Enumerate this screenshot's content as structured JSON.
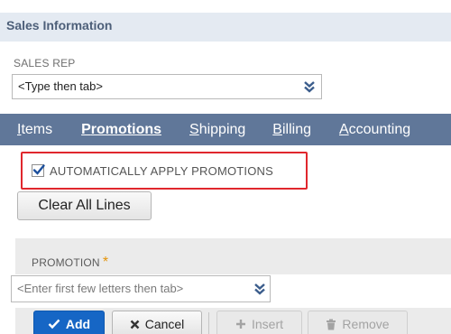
{
  "section": {
    "title": "Sales Information"
  },
  "sales_rep": {
    "label": "SALES REP",
    "value": "<Type then tab>"
  },
  "tabs": [
    {
      "first": "I",
      "rest": "tems"
    },
    {
      "first": "P",
      "rest": "romotions"
    },
    {
      "first": "S",
      "rest": "hipping"
    },
    {
      "first": "B",
      "rest": "illing"
    },
    {
      "first": "A",
      "rest": "ccounting"
    }
  ],
  "active_tab": "Promotions",
  "auto_apply": {
    "label": "AUTOMATICALLY APPLY PROMOTIONS",
    "checked": true
  },
  "clear_all": {
    "label": "Clear All Lines"
  },
  "promotion_grid": {
    "column_header": "PROMOTION",
    "required_mark": "*",
    "input_placeholder": "<Enter first few letters then tab>"
  },
  "actions": {
    "add": "Add",
    "cancel": "Cancel",
    "insert": "Insert",
    "remove": "Remove"
  },
  "colors": {
    "tab_bar": "#607799",
    "section_header": "#e4eaf2",
    "highlight_border": "#e0272d",
    "add_button": "#1666c5"
  }
}
